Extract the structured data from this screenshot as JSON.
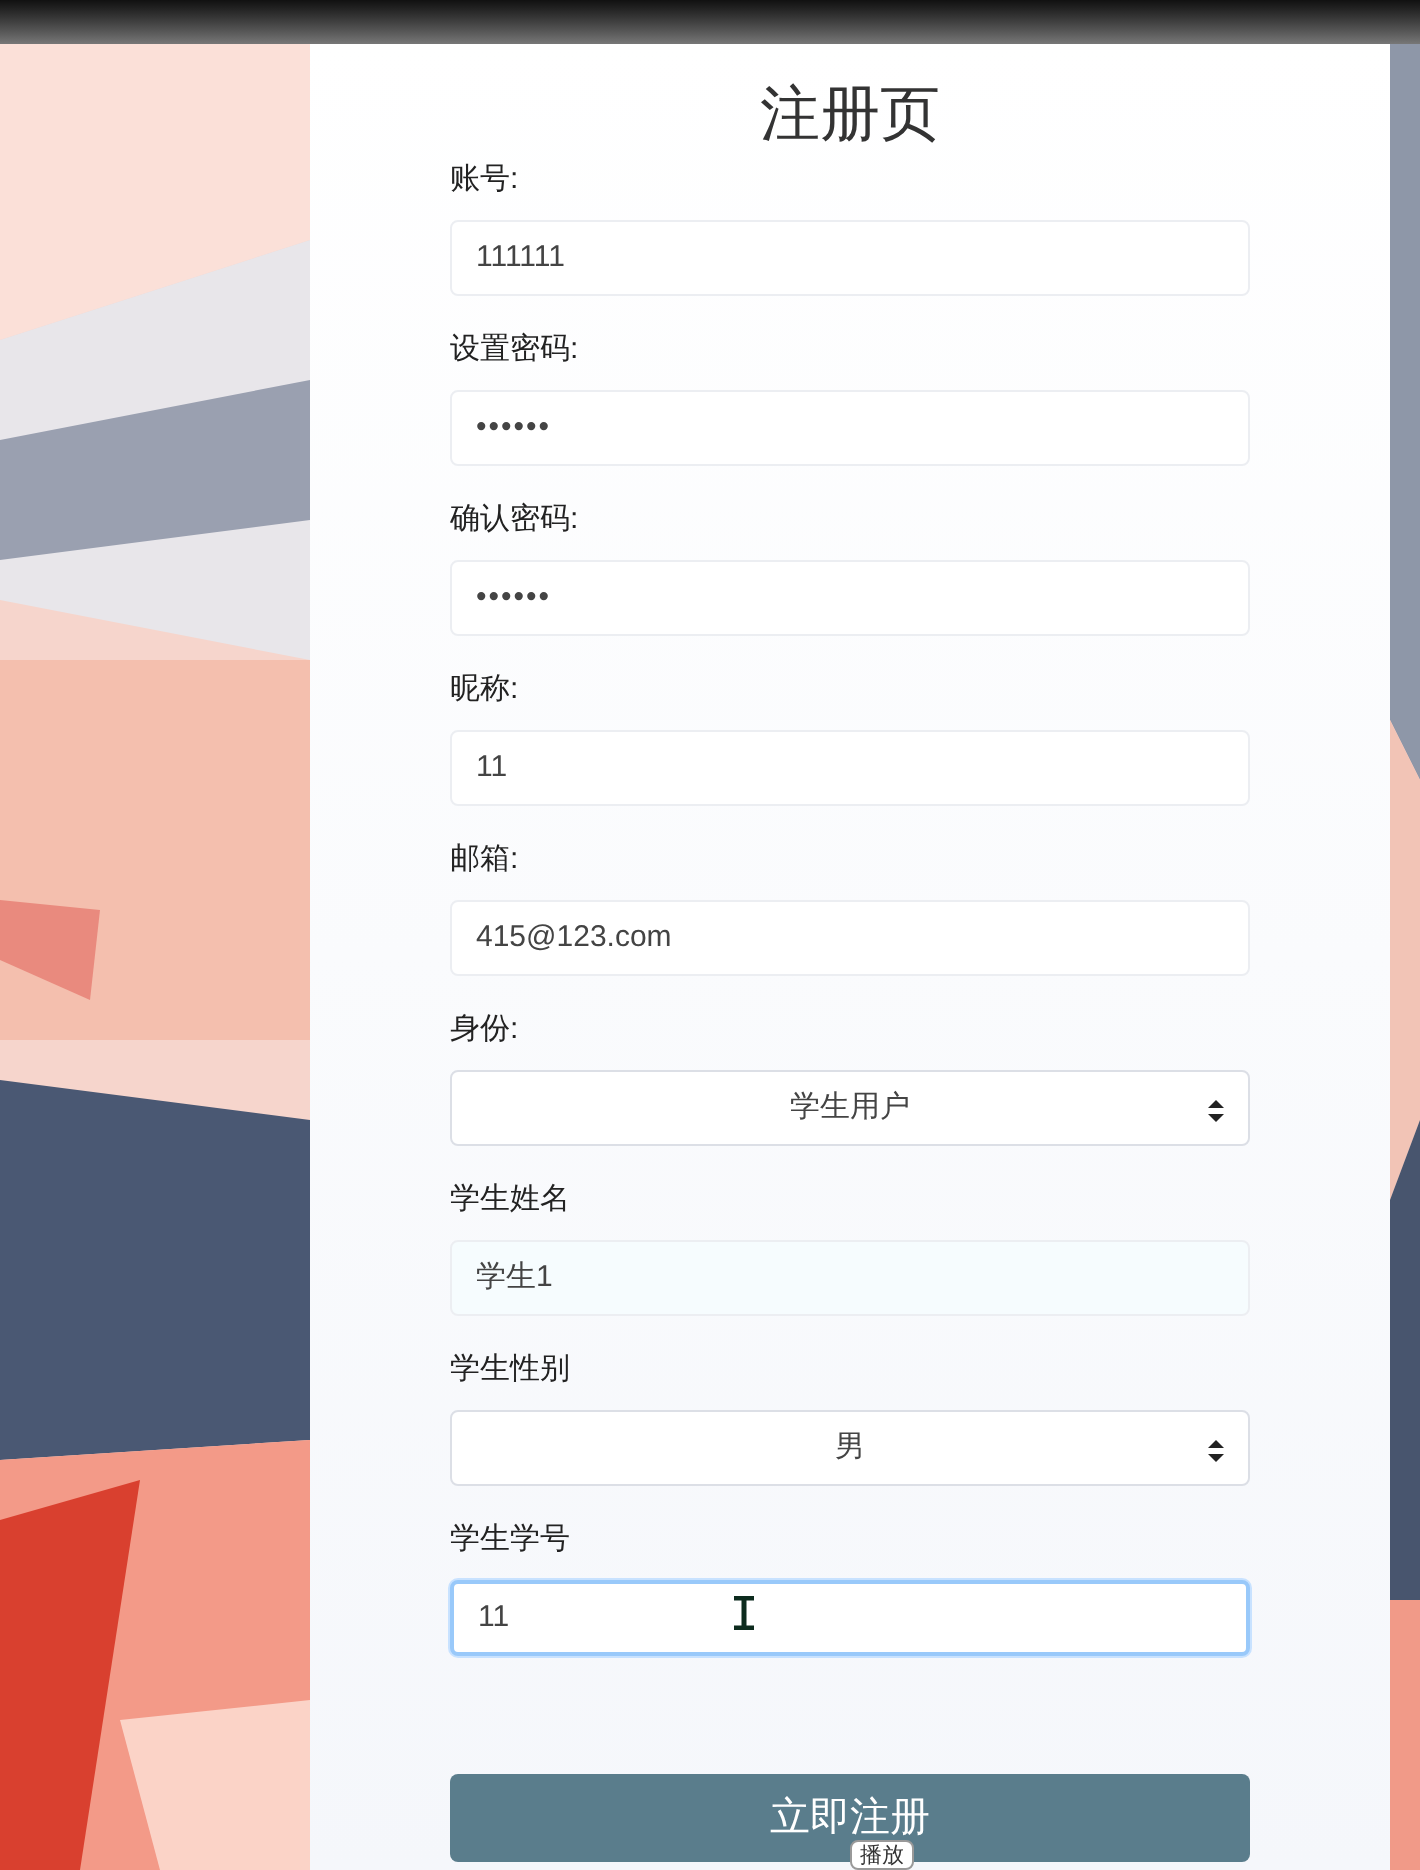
{
  "title": "注册页",
  "fields": [
    {
      "label": "账号:",
      "kind": "text",
      "value": "111111",
      "focused": false
    },
    {
      "label": "设置密码:",
      "kind": "password",
      "value": "••••••",
      "focused": false
    },
    {
      "label": "确认密码:",
      "kind": "password",
      "value": "••••••",
      "focused": false
    },
    {
      "label": "昵称:",
      "kind": "text",
      "value": "11",
      "focused": false
    },
    {
      "label": "邮箱:",
      "kind": "text",
      "value": "415@123.com",
      "focused": false
    },
    {
      "label": "身份:",
      "kind": "select",
      "value": "学生用户",
      "focused": false
    },
    {
      "label": "学生姓名",
      "kind": "autofill",
      "value": "学生1",
      "focused": false
    },
    {
      "label": "学生性别",
      "kind": "select",
      "value": "男",
      "focused": false
    },
    {
      "label": "学生学号",
      "kind": "text",
      "value": "11",
      "focused": true
    }
  ],
  "submit": "立即注册",
  "tooltip": "播放"
}
